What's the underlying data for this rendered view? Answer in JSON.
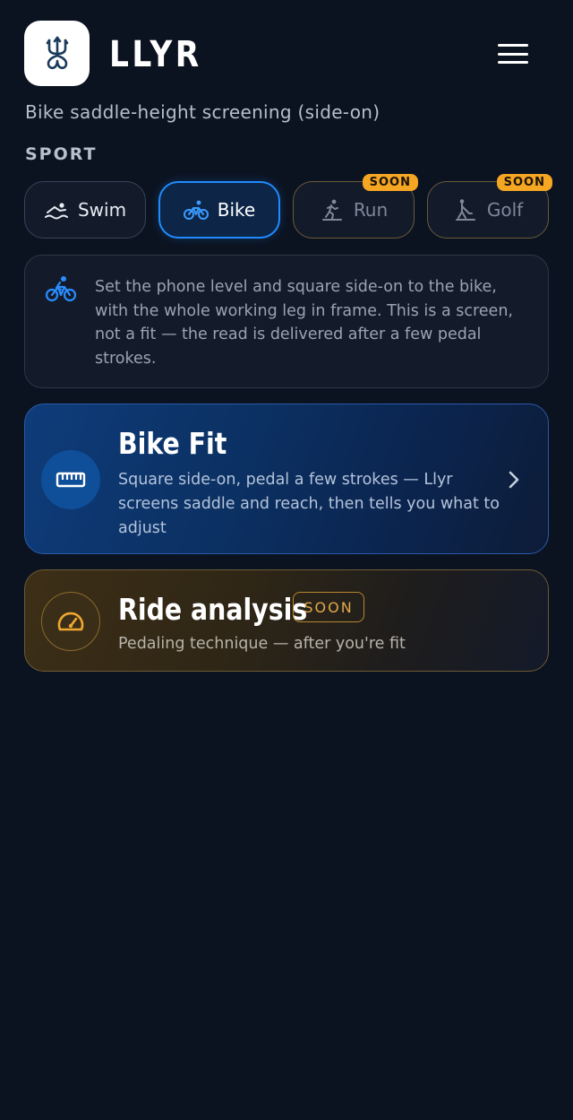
{
  "app": {
    "brand": "LLYR",
    "subtitle": "Bike saddle-height screening (side-on)",
    "menu_icon": "hamburger-menu-icon",
    "logo_icon": "trident-logo-icon"
  },
  "sport": {
    "label": "SPORT",
    "options": [
      {
        "label": "Swim",
        "icon": "swim-icon",
        "selected": false,
        "badge": ""
      },
      {
        "label": "Bike",
        "icon": "bike-icon",
        "selected": true,
        "badge": ""
      },
      {
        "label": "Run",
        "icon": "run-icon",
        "selected": false,
        "badge": "SOON"
      },
      {
        "label": "Golf",
        "icon": "golf-icon",
        "selected": false,
        "badge": "SOON"
      }
    ]
  },
  "info": {
    "icon": "cyclist-icon",
    "text": "Set the phone level and square side-on to the bike, with the whole working leg in frame. This is a screen, not a fit — the read is delivered after a few pedal strokes."
  },
  "cards": {
    "bike_fit": {
      "title": "Bike Fit",
      "description": "Square side-on, pedal a few strokes — Llyr screens saddle and reach, then tells you what to adjust",
      "icon": "ruler-icon"
    },
    "ride_analysis": {
      "title": "Ride analysis",
      "badge": "SOON",
      "description": "Pedaling technique — after you're fit",
      "icon": "speedometer-icon"
    }
  },
  "colors": {
    "background": "#0c1320",
    "accent_blue": "#1f8bff",
    "accent_gold": "#f5a623"
  }
}
